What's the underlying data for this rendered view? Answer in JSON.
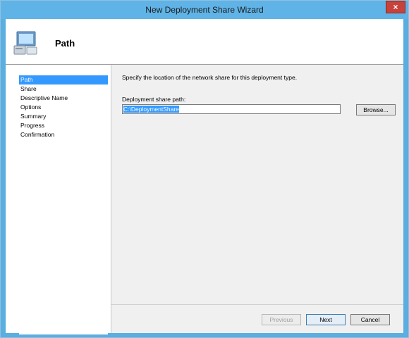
{
  "window": {
    "title": "New Deployment Share Wizard",
    "close_glyph": "×"
  },
  "header": {
    "title": "Path",
    "icon": "computer-icon"
  },
  "nav": {
    "items": [
      {
        "label": "Path",
        "selected": true
      },
      {
        "label": "Share",
        "selected": false
      },
      {
        "label": "Descriptive Name",
        "selected": false
      },
      {
        "label": "Options",
        "selected": false
      },
      {
        "label": "Summary",
        "selected": false
      },
      {
        "label": "Progress",
        "selected": false
      },
      {
        "label": "Confirmation",
        "selected": false
      }
    ]
  },
  "content": {
    "description": "Specify the location of the network share for this deployment type.",
    "path_label": "Deployment share path:",
    "path_value": "C:\\DeploymentShare",
    "browse_label": "Browse..."
  },
  "footer": {
    "previous_label": "Previous",
    "next_label": "Next",
    "cancel_label": "Cancel"
  },
  "colors": {
    "titlebar": "#60b3e6",
    "close": "#c7423b",
    "selection": "#3399ff"
  }
}
